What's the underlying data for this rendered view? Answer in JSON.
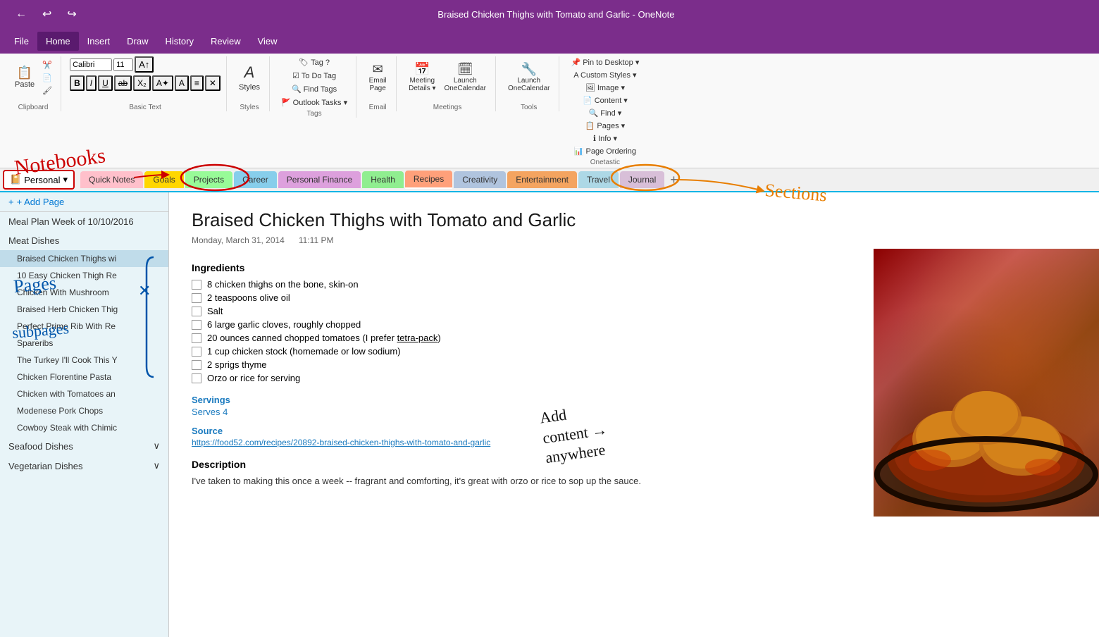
{
  "titleBar": {
    "title": "Braised Chicken Thighs with Tomato and Garlic  -  OneNote",
    "backBtn": "←",
    "undoBtn": "↩",
    "redoBtn": "↪"
  },
  "menuBar": {
    "items": [
      "File",
      "Home",
      "Insert",
      "Draw",
      "History",
      "Review",
      "View"
    ]
  },
  "tabs": {
    "notebook": "Personal",
    "sections": [
      {
        "label": "Quick Notes",
        "class": "tab-quick-notes"
      },
      {
        "label": "Goals",
        "class": "tab-goals"
      },
      {
        "label": "Projects",
        "class": "tab-projects"
      },
      {
        "label": "Career",
        "class": "tab-career"
      },
      {
        "label": "Personal Finance",
        "class": "tab-personal-finance"
      },
      {
        "label": "Health",
        "class": "tab-health"
      },
      {
        "label": "Recipes",
        "class": "tab-recipes"
      },
      {
        "label": "Creativity",
        "class": "tab-creativity"
      },
      {
        "label": "Entertainment",
        "class": "tab-entertainment"
      },
      {
        "label": "Travel",
        "class": "tab-travel"
      },
      {
        "label": "Journal",
        "class": "tab-journal"
      }
    ],
    "addBtn": "+"
  },
  "leftPanel": {
    "addPageLabel": "+ Add Page",
    "sections": [
      {
        "label": "Meal Plan Week of 10/10/2016",
        "type": "top-level"
      },
      {
        "label": "Meat Dishes",
        "type": "section",
        "pages": [
          {
            "label": "Braised Chicken Thighs wi",
            "active": true
          },
          {
            "label": "10 Easy Chicken Thigh Re"
          },
          {
            "label": "Chicken With Mushroom"
          },
          {
            "label": "Braised Herb Chicken Thig"
          },
          {
            "label": "Perfect Prime Rib With Re"
          },
          {
            "label": "Spareribs"
          },
          {
            "label": "The Turkey I'll Cook This Y"
          },
          {
            "label": "Chicken Florentine Pasta"
          },
          {
            "label": "Chicken with Tomatoes an"
          },
          {
            "label": "Modenese Pork Chops"
          },
          {
            "label": "Cowboy Steak with Chimic"
          }
        ]
      },
      {
        "label": "Seafood Dishes",
        "type": "section-collapsed"
      },
      {
        "label": "Vegetarian Dishes",
        "type": "section-collapsed"
      }
    ]
  },
  "content": {
    "title": "Braised Chicken Thighs with Tomato and Garlic",
    "date": "Monday, March 31, 2014",
    "time": "11:11 PM",
    "ingredientsHeading": "Ingredients",
    "ingredients": [
      "8 chicken thighs on the bone, skin-on",
      "2 teaspoons olive oil",
      "Salt",
      "6 large garlic cloves, roughly chopped",
      "20 ounces canned chopped tomatoes (I prefer tetra-pack)",
      "1 cup chicken stock (homemade or low sodium)",
      "2 sprigs thyme",
      "Orzo or rice for serving"
    ],
    "servingsLabel": "Servings",
    "servingsValue": "Serves 4",
    "sourceLabel": "Source",
    "sourceLink": "https://food52.com/recipes/20892-braised-chicken-thighs-with-tomato-and-garlic",
    "descriptionHeading": "Description",
    "descriptionText": "I've taken to making this once a week -- fragrant and comforting, it's great with orzo or rice to sop up the sauce."
  },
  "annotations": {
    "notebooks": "Notebooks",
    "pages": "pages\nsubpages",
    "addContent": "Add\ncontent →\nanywhere",
    "sections": "Sections"
  },
  "ribbon": {
    "paste": "Paste",
    "clipboard": "Clipboard",
    "basicText": "Basic Text",
    "styles": "Styles",
    "tags": "Tags",
    "email": "Email",
    "meetings": "Meetings",
    "tools": "Tools",
    "onetastic": "Onetastic",
    "tagBtn": "Tag",
    "toDoTag": "To Do Tag",
    "findTags": "Find Tags",
    "outlookTasks": "Outlook Tasks ▾",
    "emailPage": "Email\nPage",
    "meetingDetails": "Meeting\nDetails ▾",
    "launchOneCalendar": "Launch\nOneCalendar",
    "pinToDesktop": "Pin to Desktop ▾",
    "customStyles": "Custom Styles ▾",
    "image": "Image ▾",
    "content": "Content ▾",
    "find": "Find ▾",
    "pages": "Pages ▾",
    "info": "Info ▾",
    "pageOrdering": "Page Ordering"
  }
}
